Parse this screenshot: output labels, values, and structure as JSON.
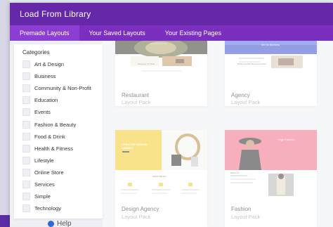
{
  "modal": {
    "title": "Load From Library",
    "tabs": [
      "Premade Layouts",
      "Your Saved Layouts",
      "Your Existing Pages"
    ]
  },
  "sidebar": {
    "title": "Categories",
    "categories": [
      "Art & Design",
      "Business",
      "Community & Non-Profit",
      "Education",
      "Events",
      "Fashion & Beauty",
      "Food & Drink",
      "Health & Fitness",
      "Lifestyle",
      "Online Store",
      "Services",
      "Simple",
      "Technology"
    ]
  },
  "layouts": [
    {
      "name": "Restaurant",
      "type": "Layout Pack",
      "thumb_text": "Only Quality Food",
      "thumb_sub": "Welcome To Stark"
    },
    {
      "name": "Agency",
      "type": "Layout Pack",
      "thumb_text": "Divi for Business",
      "thumb_sub": "Building Scalable Businesses Online"
    },
    {
      "name": "Design Agency",
      "type": "Layout Pack",
      "thumb_text": "CREATIVE DESIGN AGENCY",
      "thumb_sub": "WHAT WE DO"
    },
    {
      "name": "Fashion",
      "type": "Layout Pack",
      "thumb_text": "High Fashion",
      "thumb_sub": "About Us"
    }
  ],
  "footer": {
    "help_label": "Help"
  },
  "colors": {
    "header": "#6428a8",
    "tabs": "#7a2fbe",
    "accent_yellow": "#f2cb2a",
    "accent_pink": "#f06d84"
  }
}
